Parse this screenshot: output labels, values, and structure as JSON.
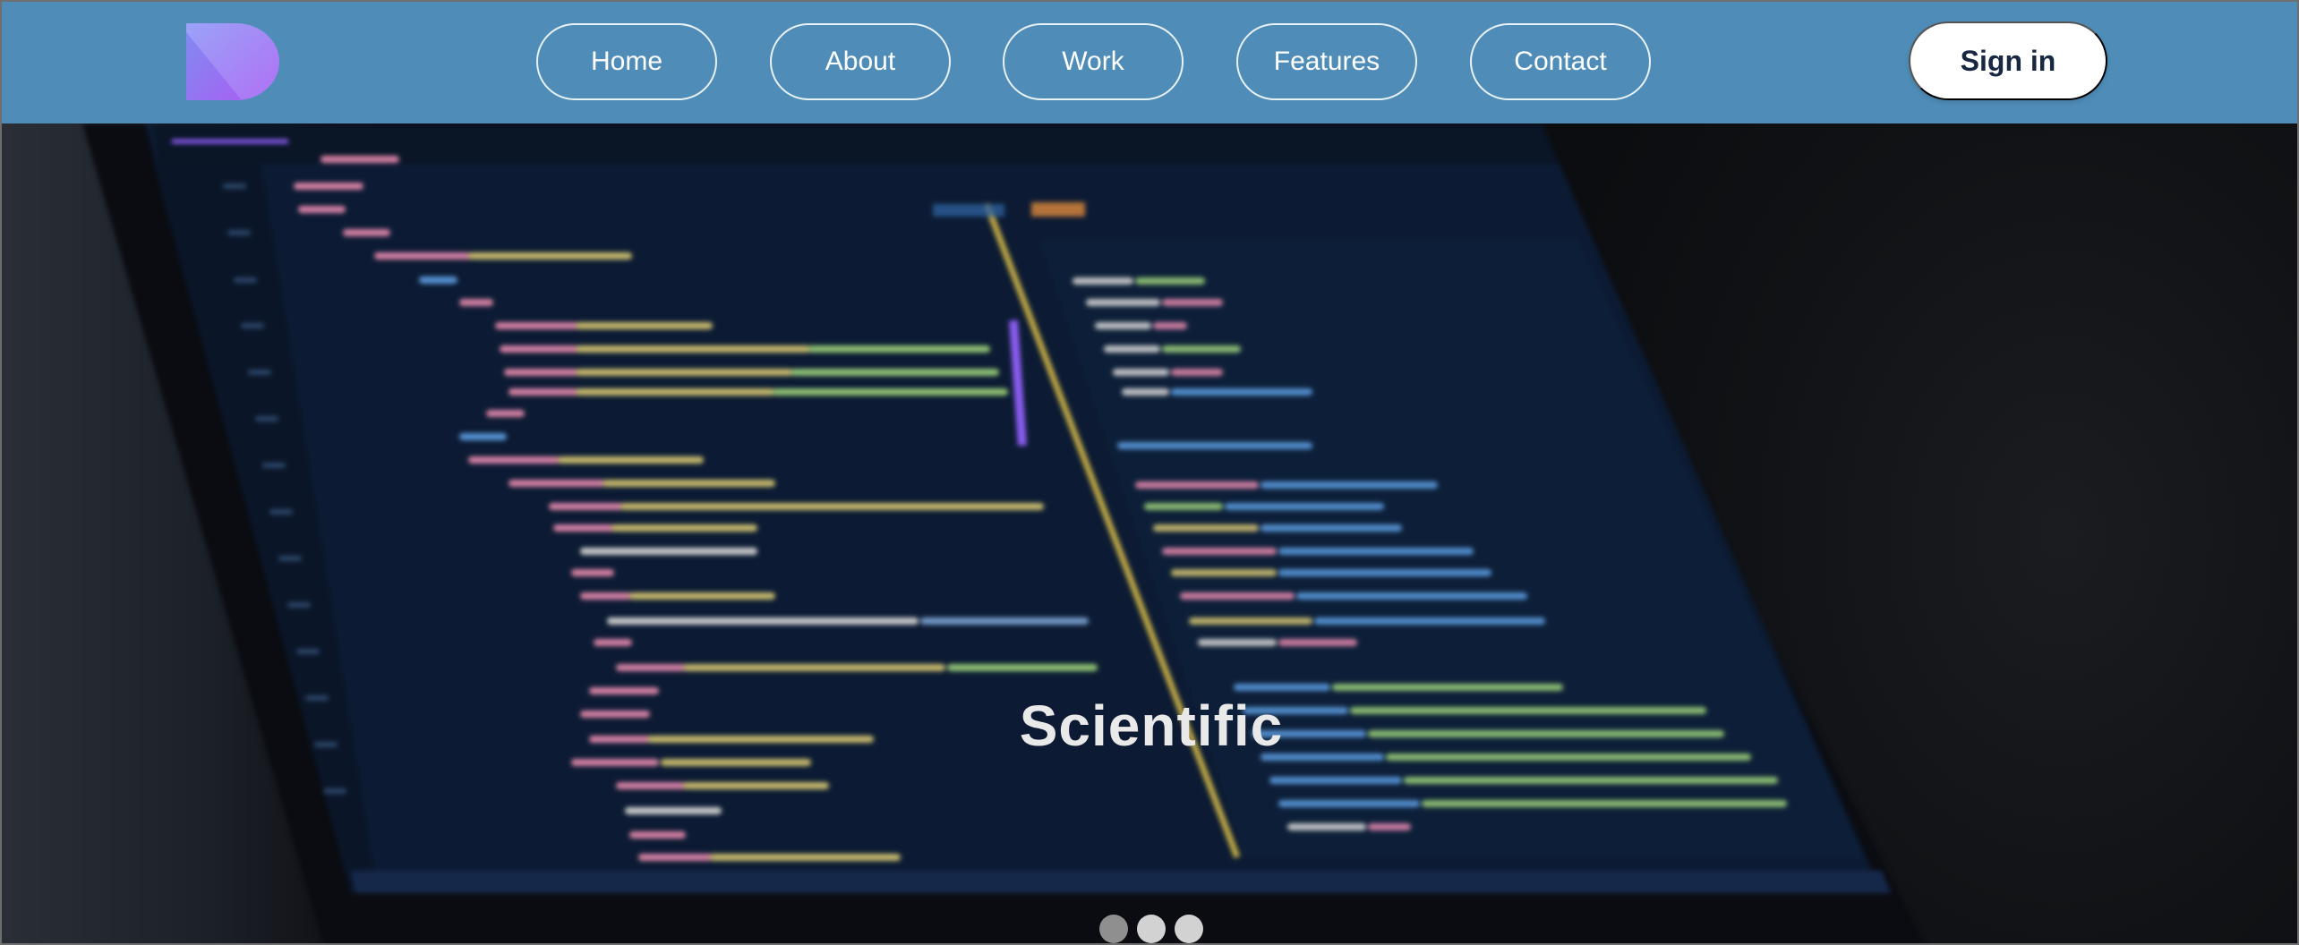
{
  "nav": {
    "logo_icon": "d-logo-icon",
    "links": [
      {
        "label": "Home"
      },
      {
        "label": "About"
      },
      {
        "label": "Work"
      },
      {
        "label": "Features"
      },
      {
        "label": "Contact"
      }
    ],
    "signin_label": "Sign in"
  },
  "hero": {
    "title": "Scientific",
    "background_image": "blurred laptop screen showing code editor",
    "slides": 3,
    "active_slide": 1
  },
  "colors": {
    "nav_bg": "#4f8db8",
    "signin_bg": "#ffffff",
    "signin_text": "#182842",
    "hero_title": "#e9e9e9",
    "logo_gradient_start": "#8b8df8",
    "logo_gradient_end": "#b46cf6"
  }
}
